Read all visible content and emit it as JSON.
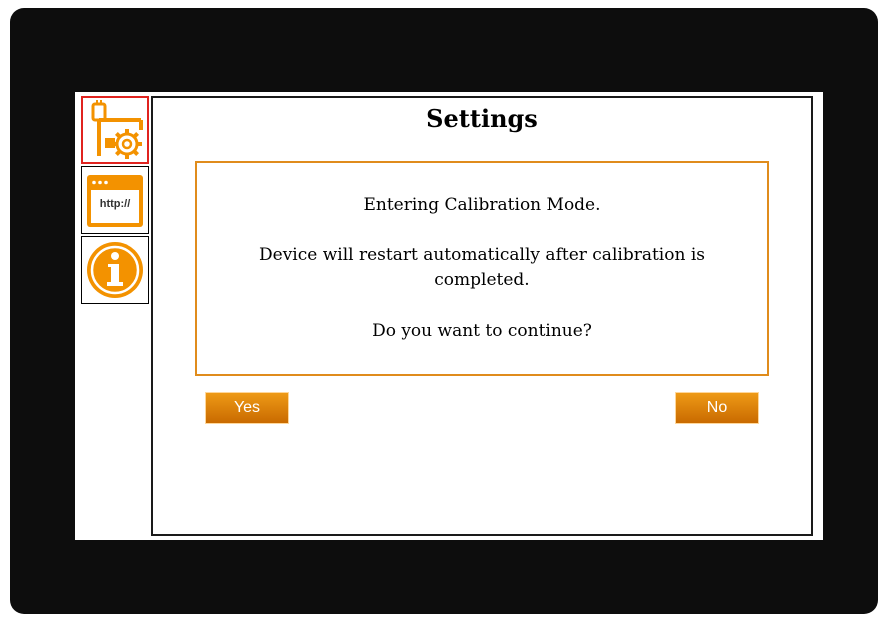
{
  "header": {
    "title": "Settings"
  },
  "sidebar": {
    "items": [
      {
        "icon": "settings-gear-icon",
        "active": true
      },
      {
        "icon": "http-browser-icon",
        "label": "http://",
        "active": false
      },
      {
        "icon": "info-icon",
        "active": false
      }
    ]
  },
  "dialog": {
    "line1": "Entering Calibration Mode.",
    "line2": "Device will restart automatically after calibration is completed.",
    "line3": "Do you want to continue?"
  },
  "buttons": {
    "yes_label": "Yes",
    "no_label": "No"
  },
  "colors": {
    "accent": "#f39200",
    "active_border": "#e0231f",
    "dialog_border": "#e08c1c"
  }
}
